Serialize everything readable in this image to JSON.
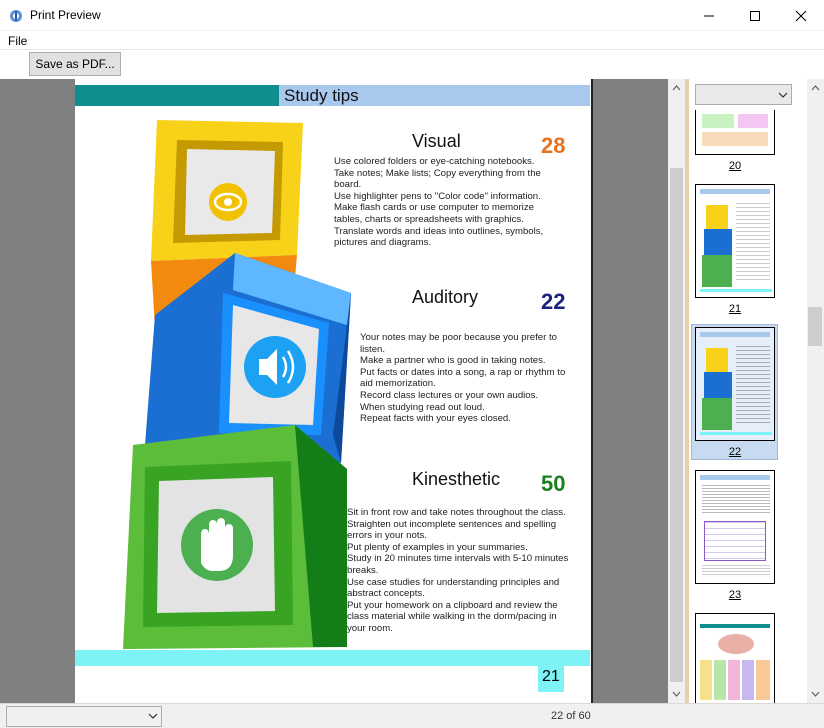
{
  "window": {
    "title": "Print Preview",
    "app_icon": "print-preview-icon",
    "minimize_icon": "minimize-icon",
    "maximize_icon": "maximize-icon",
    "close_icon": "close-icon"
  },
  "menu": {
    "file": "File"
  },
  "toolbar": {
    "save_pdf": "Save as PDF..."
  },
  "page": {
    "title": "Study tips",
    "page_number": "21",
    "sections": [
      {
        "heading": "Visual",
        "count": "28",
        "count_color": "#e8731f",
        "icon": "eye-icon",
        "text": "Use colored folders or eye-catching notebooks.\nTake notes; Make lists; Copy everything from the\nboard.\nUse highlighter pens to \"Color code\" information.\nMake flash cards or use computer to memorize\ntables, charts or spreadsheets with graphics.\nTranslate words and ideas into outlines, symbols,\npictures and diagrams."
      },
      {
        "heading": "Auditory",
        "count": "22",
        "count_color": "#1a237e",
        "icon": "speaker-icon",
        "text": "Your notes may be poor because you prefer to\nlisten.\nMake a partner who is good in taking notes.\nPut facts or dates into a song, a rap or rhythm to\naid memorization.\nRecord class lectures or your own audios.\nWhen studying read out loud.\nRepeat facts with your eyes closed."
      },
      {
        "heading": "Kinesthetic",
        "count": "50",
        "count_color": "#1b7e1f",
        "icon": "hand-icon",
        "text": "Sit in front row and take notes throughout the class.\nStraighten out incomplete sentences and spelling\nerrors in your nots.\nPut plenty of examples in your summaries.\nStudy in 20 minutes time intervals with 5-10 minutes\nbreaks.\nUse case studies for understanding principles and\nabstract concepts.\nPut your homework on a clipboard and review the\nclass material while walking in the dorm/pacing in\nyour room."
      }
    ]
  },
  "thumbnails": [
    {
      "label": "20"
    },
    {
      "label": "21"
    },
    {
      "label": "22"
    },
    {
      "label": "23"
    }
  ],
  "status": {
    "page_of": "22 of 60"
  },
  "colors": {
    "teal_bar": "#0e8e8e",
    "title_bar": "#a9c8ee",
    "footer_bar": "#7ef3f5",
    "selected_thumb": "#c8daf0"
  }
}
